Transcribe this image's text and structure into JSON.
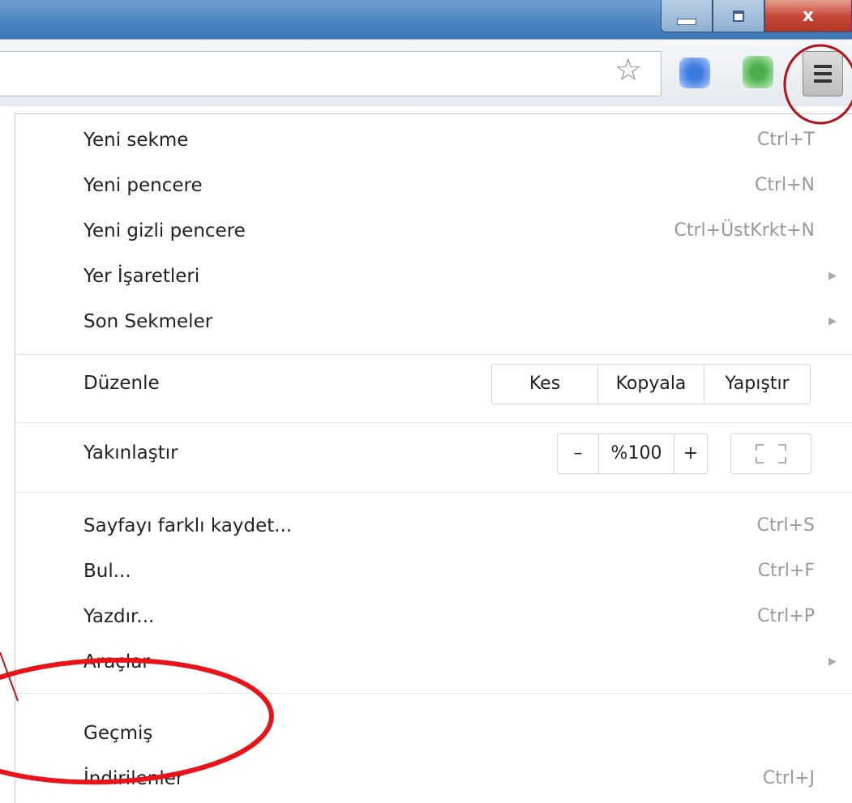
{
  "window": {
    "minimize_icon": "minimize-icon",
    "maximize_icon": "maximize-icon",
    "close_label": "x"
  },
  "toolbar": {
    "star_icon": "star-outline-icon",
    "menu_icon": "hamburger-icon"
  },
  "menu": {
    "items": [
      {
        "label": "Yeni sekme",
        "shortcut": "Ctrl+T"
      },
      {
        "label": "Yeni pencere",
        "shortcut": "Ctrl+N"
      },
      {
        "label": "Yeni gizli pencere",
        "shortcut": "Ctrl+ÜstKrkt+N"
      },
      {
        "label": "Yer İşaretleri",
        "submenu": true
      },
      {
        "label": "Son Sekmeler",
        "submenu": true
      }
    ],
    "edit": {
      "label": "Düzenle",
      "cut": "Kes",
      "copy": "Kopyala",
      "paste": "Yapıştır"
    },
    "zoom": {
      "label": "Yakınlaştır",
      "minus": "–",
      "value": "%100",
      "plus": "+"
    },
    "items2": [
      {
        "label": "Sayfayı farklı kaydet...",
        "shortcut": "Ctrl+S"
      },
      {
        "label": "Bul...",
        "shortcut": "Ctrl+F"
      },
      {
        "label": "Yazdır...",
        "shortcut": "Ctrl+P"
      },
      {
        "label": "Araçlar",
        "submenu": true
      }
    ],
    "items3": [
      {
        "label": "Geçmiş",
        "shortcut": ""
      },
      {
        "label": "İndirilenler",
        "shortcut": "Ctrl+J"
      }
    ]
  },
  "colors": {
    "annotation": "#e8141a",
    "titlebar": "#4e86c4"
  }
}
